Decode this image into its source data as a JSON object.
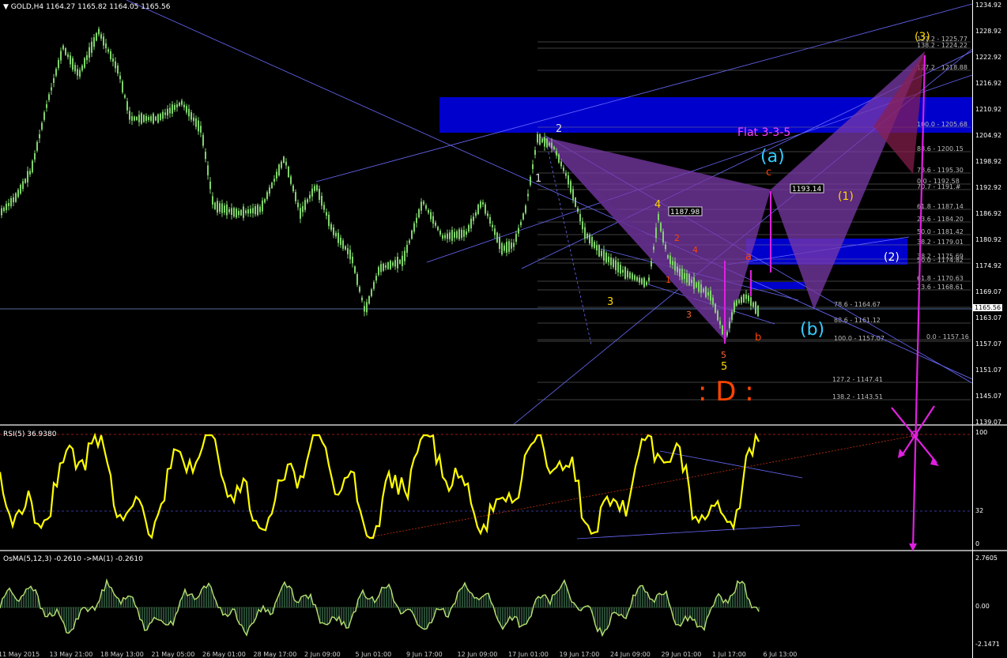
{
  "header": {
    "symbol": "GOLD,H4",
    "ohlc": "1164.27 1165.82 1164.05 1165.56",
    "rsi_label": "RSI(5) 36.9380",
    "osma_label": "OsMA(5,12,3) -0.2610  ->MA(1) -0.2610"
  },
  "price_axis": {
    "ticks": [
      "1234.92",
      "1228.92",
      "1222.92",
      "1216.92",
      "1210.92",
      "1204.92",
      "1198.92",
      "1192.92",
      "1186.92",
      "1180.92",
      "1174.92",
      "1169.07",
      "1163.07",
      "1157.07",
      "1151.07",
      "1145.07",
      "1139.07"
    ],
    "bid": "1165.56"
  },
  "rsi_axis": {
    "ticks": [
      "100",
      "32",
      "0"
    ]
  },
  "osma_axis": {
    "ticks": [
      "2.7605",
      "0.00",
      "-2.1471"
    ]
  },
  "time_axis": {
    "labels": [
      "11 May 2015",
      "13 May 21:00",
      "18 May 13:00",
      "21 May 05:00",
      "26 May 01:00",
      "28 May 17:00",
      "2 Jun 09:00",
      "5 Jun 01:00",
      "9 Jun 17:00",
      "12 Jun 09:00",
      "17 Jun 01:00",
      "19 Jun 17:00",
      "24 Jun 09:00",
      "29 Jun 01:00",
      "1 Jul 17:00",
      "6 Jul 13:00"
    ]
  },
  "annotations": {
    "flat": "Flat 3-3-5",
    "wave_a": "(a)",
    "wave_b": "(b)",
    "wave_c": "c",
    "small_a": "a",
    "small_b": "b",
    "wave1": "(1)",
    "wave2": "(2)",
    "wave3": "(3)",
    "d_label": ": D :",
    "n2": "2",
    "n1": "1",
    "n3": "3",
    "n4": "4",
    "n5": "5",
    "n5b": "5",
    "o1": "1",
    "o2": "2",
    "o3": "3",
    "o4": "4",
    "box1": "1187.98",
    "box2": "1193.14"
  },
  "fib_levels_upper": [
    {
      "label": "127.2 - 1225.77"
    },
    {
      "label": "138.2 - 1224.22"
    },
    {
      "label": "127.2 - 1218.88"
    },
    {
      "label": "100.0 - 1205.68"
    },
    {
      "label": "88.6 - 1200.15"
    },
    {
      "label": "78.6 - 1195.30"
    },
    {
      "label": "0.0 - 1192.58"
    },
    {
      "label": "70.7 - 1191.#"
    },
    {
      "label": "61.8 - 1187.14"
    },
    {
      "label": "23.6 - 1184.20"
    },
    {
      "label": "50.0 - 1181.42"
    },
    {
      "label": "38.2 - 1179.01"
    },
    {
      "label": "38.2 - 1175.69"
    },
    {
      "label": "50.0 - 1174.82"
    },
    {
      "label": "61.8 - 1170.63"
    },
    {
      "label": "23.6 - 1168.61"
    },
    {
      "label": "78.6 - 1164.67"
    },
    {
      "label": "88.6 - 1161.12"
    },
    {
      "label": "100.0 - 1157.07"
    },
    {
      "label": "0.0 - 1157.16"
    },
    {
      "label": "127.2 - 1147.41"
    },
    {
      "label": "138.2 - 1143.51"
    }
  ],
  "colors": {
    "bull": "#7fd36b",
    "rsi_line": "#ffff00",
    "trend": "#6a6aff",
    "zone": "#0000cc",
    "magenta": "#e020e0",
    "harmonic": "#7a3aa8"
  }
}
